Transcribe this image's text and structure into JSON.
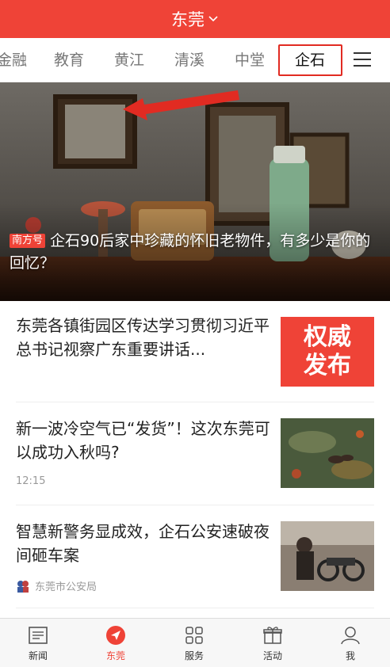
{
  "header": {
    "city": "东莞"
  },
  "tabs": [
    {
      "label": "金融"
    },
    {
      "label": "教育"
    },
    {
      "label": "黄江"
    },
    {
      "label": "清溪"
    },
    {
      "label": "中堂"
    },
    {
      "label": "企石",
      "active": true
    }
  ],
  "hero": {
    "badge": "南方号",
    "title": "企石90后家中珍藏的怀旧老物件，有多少是你的回忆？"
  },
  "news": [
    {
      "title": "东莞各镇街园区传达学习贯彻习近平总书记视察广东重要讲话...",
      "thumb_text": [
        "权威",
        "发布"
      ]
    },
    {
      "title": "新一波冷空气已“发货”！这次东莞可以成功入秋吗?",
      "time": "12:15"
    },
    {
      "title": "智慧新警务显成效，企石公安速破夜间砸车案",
      "source": "东莞市公安局"
    }
  ],
  "bottom_nav": [
    {
      "label": "新闻",
      "icon": "newspaper-icon"
    },
    {
      "label": "东莞",
      "icon": "location-arrow-icon",
      "active": true
    },
    {
      "label": "服务",
      "icon": "grid-icon"
    },
    {
      "label": "活动",
      "icon": "gift-icon"
    },
    {
      "label": "我",
      "icon": "user-icon"
    }
  ],
  "colors": {
    "accent": "#ef4337",
    "highlight_box": "#e12b22"
  }
}
